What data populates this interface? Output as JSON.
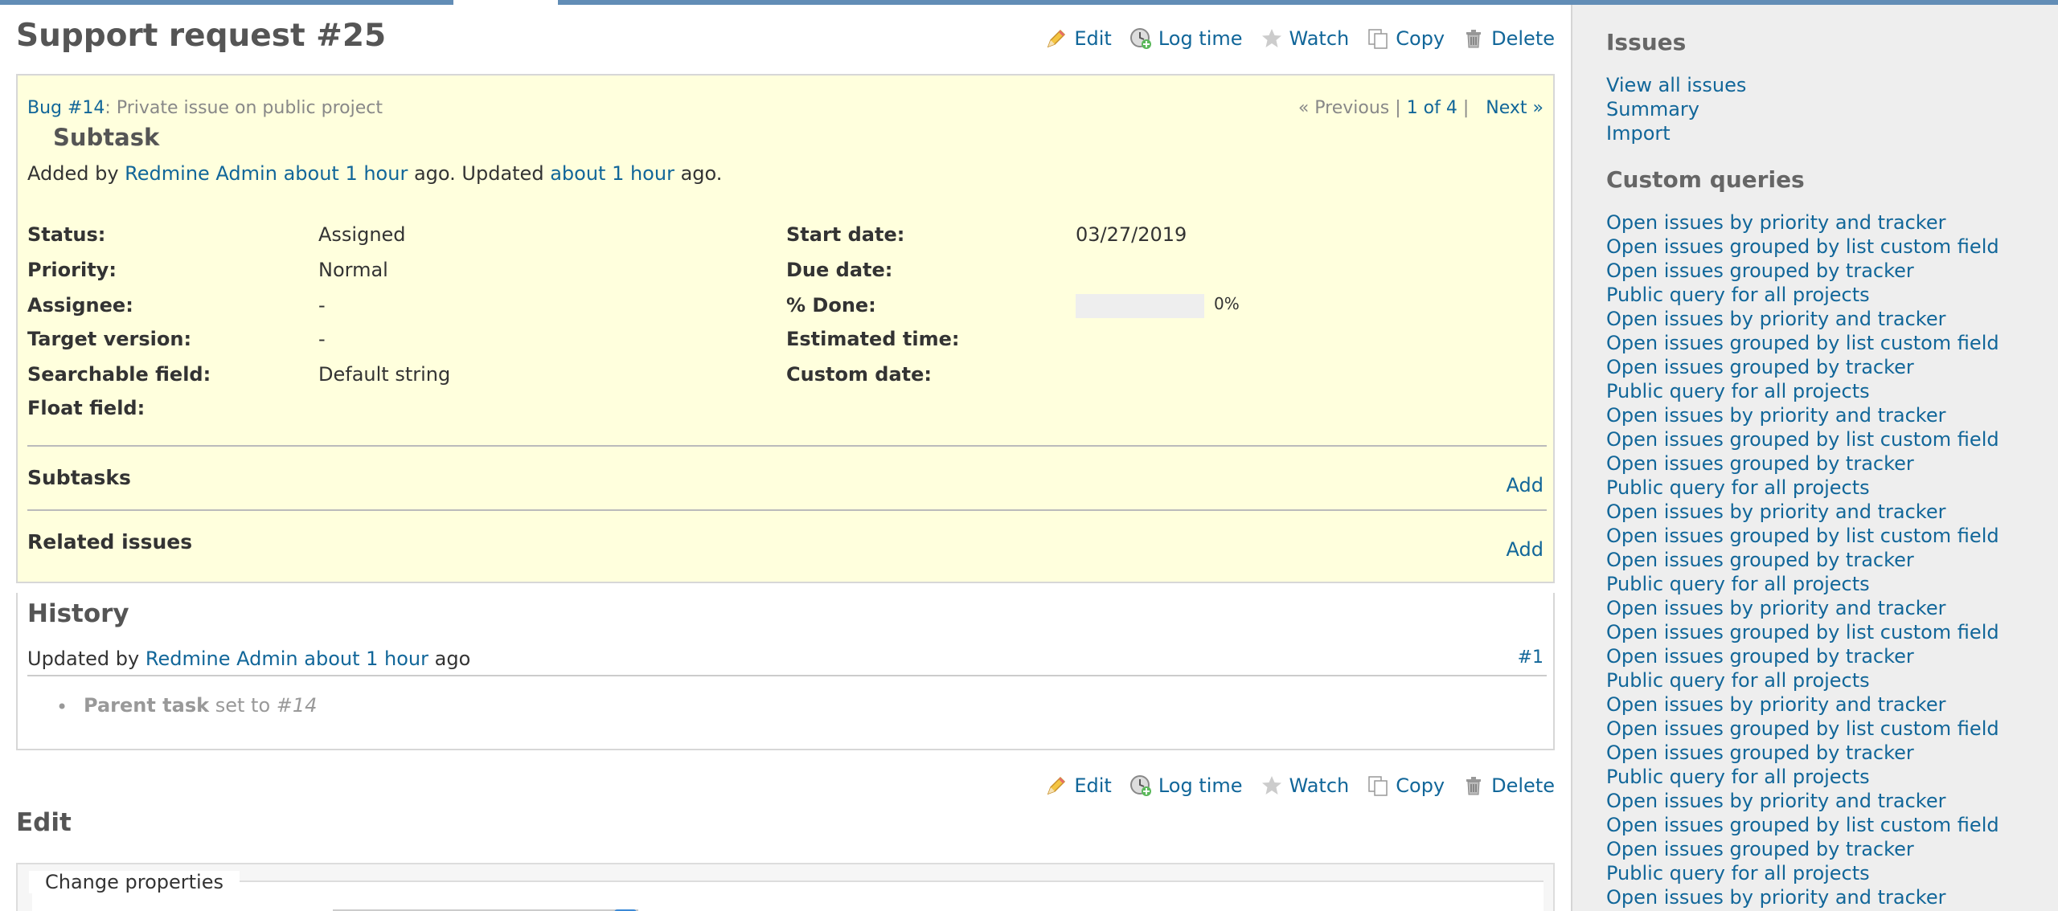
{
  "page": {
    "title": "Support request #25"
  },
  "toolbar": {
    "edit_label": "Edit",
    "log_time_label": "Log time",
    "watch_label": "Watch",
    "copy_label": "Copy",
    "delete_label": "Delete"
  },
  "issue": {
    "parent_link": "Bug #14",
    "parent_subject": ": Private issue on public project",
    "subject": "Subtask",
    "added_by_prefix": "Added by ",
    "author": "Redmine Admin",
    "created_ago": "about 1 hour",
    "updated_text": " ago. Updated ",
    "updated_ago": "about 1 hour",
    "ago_suffix": " ago.",
    "nav_previous": "« Previous",
    "nav_separator": " | ",
    "nav_position": "1 of 4",
    "nav_separator2": " | ",
    "nav_next": "Next »"
  },
  "attributes": {
    "status_label": "Status:",
    "status_value": "Assigned",
    "priority_label": "Priority:",
    "priority_value": "Normal",
    "assignee_label": "Assignee:",
    "assignee_value": "-",
    "target_version_label": "Target version:",
    "target_version_value": "-",
    "searchable_label": "Searchable field:",
    "searchable_value": "Default string",
    "float_label": "Float field:",
    "start_date_label": "Start date:",
    "start_date_value": "03/27/2019",
    "due_date_label": "Due date:",
    "done_label": "% Done:",
    "done_value": "0%",
    "done_fraction": 0,
    "estimated_label": "Estimated time:",
    "custom_date_label": "Custom date:"
  },
  "subtasks": {
    "title": "Subtasks",
    "add_label": "Add"
  },
  "related": {
    "title": "Related issues",
    "add_label": "Add"
  },
  "history": {
    "title": "History",
    "updated_by": "Updated by ",
    "author": "Redmine Admin",
    "ago_link": "about 1 hour",
    "ago_suffix": " ago",
    "journal_number": "#1",
    "detail_field": "Parent task",
    "detail_text": " set to ",
    "detail_value": "#14"
  },
  "edit": {
    "title": "Edit",
    "legend": "Change properties"
  },
  "sidebar": {
    "issues_heading": "Issues",
    "issue_links": [
      "View all issues",
      "Summary",
      "Import"
    ],
    "queries_heading": "Custom queries",
    "query_links": [
      "Open issues by priority and tracker",
      "Open issues grouped by list custom field",
      "Open issues grouped by tracker",
      "Public query for all projects",
      "Open issues by priority and tracker",
      "Open issues grouped by list custom field",
      "Open issues grouped by tracker",
      "Public query for all projects",
      "Open issues by priority and tracker",
      "Open issues grouped by list custom field",
      "Open issues grouped by tracker",
      "Public query for all projects",
      "Open issues by priority and tracker",
      "Open issues grouped by list custom field",
      "Open issues grouped by tracker",
      "Public query for all projects",
      "Open issues by priority and tracker",
      "Open issues grouped by list custom field",
      "Open issues grouped by tracker",
      "Public query for all projects",
      "Open issues by priority and tracker",
      "Open issues grouped by list custom field",
      "Open issues grouped by tracker",
      "Public query for all projects",
      "Open issues by priority and tracker",
      "Open issues grouped by list custom field",
      "Open issues grouped by tracker",
      "Public query for all projects",
      "Open issues by priority and tracker"
    ]
  }
}
